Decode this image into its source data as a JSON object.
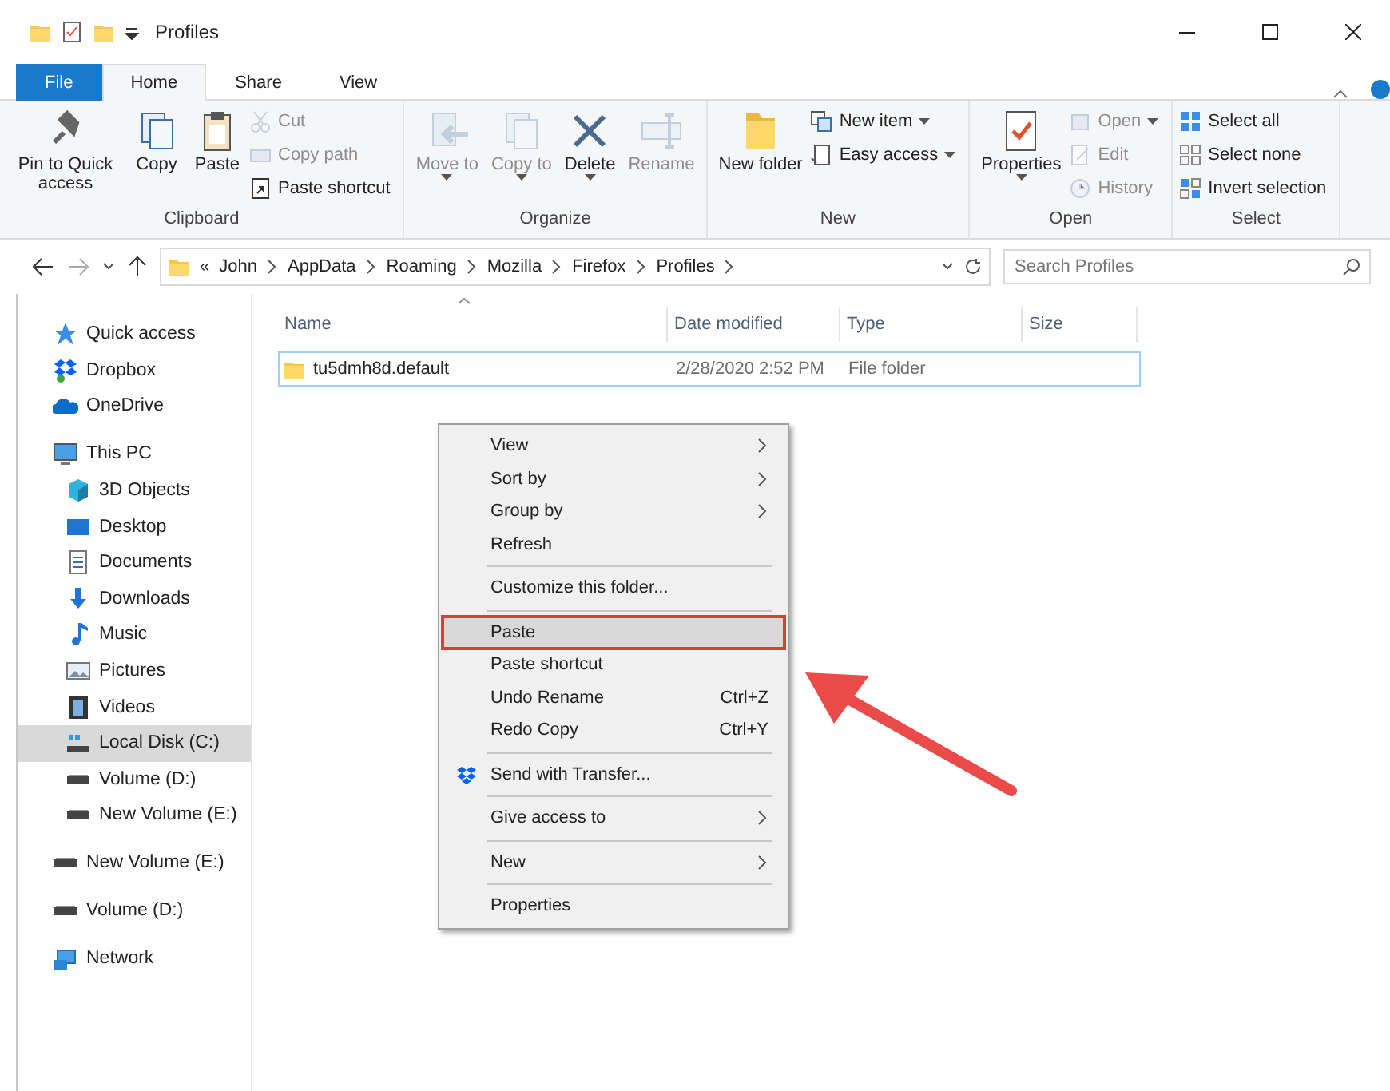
{
  "window": {
    "title": "Profiles"
  },
  "tabs": [
    {
      "label": "File",
      "kind": "file",
      "selected": false
    },
    {
      "label": "Home",
      "kind": "tab",
      "selected": true
    },
    {
      "label": "Share",
      "kind": "tab",
      "selected": false
    },
    {
      "label": "View",
      "kind": "tab",
      "selected": false
    }
  ],
  "ribbon": [
    {
      "name": "Clipboard",
      "items": [
        {
          "label": "Pin to Quick access",
          "kind": "large",
          "disabled": false
        },
        {
          "label": "Copy",
          "kind": "large",
          "disabled": false
        },
        {
          "label": "Paste",
          "kind": "large",
          "disabled": false
        },
        {
          "label": "Cut",
          "kind": "small",
          "disabled": true
        },
        {
          "label": "Copy path",
          "kind": "small",
          "disabled": true
        },
        {
          "label": "Paste shortcut",
          "kind": "small",
          "disabled": false
        }
      ]
    },
    {
      "name": "Organize",
      "items": [
        {
          "label": "Move to",
          "kind": "large",
          "disabled": true,
          "dropdown": true
        },
        {
          "label": "Copy to",
          "kind": "large",
          "disabled": true,
          "dropdown": true
        },
        {
          "label": "Delete",
          "kind": "large",
          "disabled": false,
          "dropdown": true
        },
        {
          "label": "Rename",
          "kind": "large",
          "disabled": true
        }
      ]
    },
    {
      "name": "New",
      "items": [
        {
          "label": "New folder",
          "kind": "large",
          "disabled": false
        },
        {
          "label": "New item",
          "kind": "small",
          "disabled": false,
          "dropdown": true
        },
        {
          "label": "Easy access",
          "kind": "small",
          "disabled": false,
          "dropdown": true
        }
      ]
    },
    {
      "name": "Open",
      "items": [
        {
          "label": "Properties",
          "kind": "large",
          "disabled": false,
          "dropdown": true
        },
        {
          "label": "Open",
          "kind": "small",
          "disabled": true,
          "dropdown": true
        },
        {
          "label": "Edit",
          "kind": "small",
          "disabled": true
        },
        {
          "label": "History",
          "kind": "small",
          "disabled": true
        }
      ]
    },
    {
      "name": "Select",
      "items": [
        {
          "label": "Select all",
          "kind": "small",
          "disabled": false
        },
        {
          "label": "Select none",
          "kind": "small",
          "disabled": false
        },
        {
          "label": "Invert selection",
          "kind": "small",
          "disabled": false
        }
      ]
    }
  ],
  "address": {
    "overflow": "«",
    "crumbs": [
      "John",
      "AppData",
      "Roaming",
      "Mozilla",
      "Firefox",
      "Profiles"
    ]
  },
  "search": {
    "placeholder": "Search Profiles"
  },
  "sidebar": [
    {
      "label": "Quick access",
      "kind": "star",
      "selected": false
    },
    {
      "label": "Dropbox",
      "kind": "dropbox",
      "selected": false
    },
    {
      "label": "OneDrive",
      "kind": "cloud",
      "selected": false
    },
    {
      "label": "This PC",
      "kind": "pc",
      "selected": false,
      "children": [
        {
          "label": "3D Objects",
          "kind": "cube",
          "selected": false
        },
        {
          "label": "Desktop",
          "kind": "desktop",
          "selected": false
        },
        {
          "label": "Documents",
          "kind": "doc",
          "selected": false
        },
        {
          "label": "Downloads",
          "kind": "download",
          "selected": false
        },
        {
          "label": "Music",
          "kind": "music",
          "selected": false
        },
        {
          "label": "Pictures",
          "kind": "picture",
          "selected": false
        },
        {
          "label": "Videos",
          "kind": "video",
          "selected": false
        },
        {
          "label": "Local Disk (C:)",
          "kind": "windisk",
          "selected": true
        },
        {
          "label": "Volume (D:)",
          "kind": "drive",
          "selected": false
        },
        {
          "label": "New Volume (E:)",
          "kind": "drive",
          "selected": false
        }
      ]
    },
    {
      "label": "New Volume (E:)",
      "kind": "drive",
      "selected": false
    },
    {
      "label": "Volume (D:)",
      "kind": "drive",
      "selected": false
    },
    {
      "label": "Network",
      "kind": "network",
      "selected": false
    }
  ],
  "table": {
    "columns": [
      "Name",
      "Date modified",
      "Type",
      "Size"
    ],
    "rows": [
      {
        "cells": [
          "tu5dmh8d.default",
          "2/28/2020 2:52 PM",
          "File folder"
        ],
        "focused": true
      }
    ]
  },
  "context_menu": [
    {
      "kind": "item",
      "label": "View",
      "submenu": true,
      "highlighted": false
    },
    {
      "kind": "item",
      "label": "Sort by",
      "submenu": true,
      "highlighted": false
    },
    {
      "kind": "item",
      "label": "Group by",
      "submenu": true,
      "highlighted": false
    },
    {
      "kind": "item",
      "label": "Refresh",
      "submenu": false,
      "highlighted": false
    },
    {
      "kind": "separator"
    },
    {
      "kind": "item",
      "label": "Customize this folder...",
      "submenu": false,
      "highlighted": false
    },
    {
      "kind": "separator"
    },
    {
      "kind": "item",
      "label": "Paste",
      "submenu": false,
      "highlighted": true
    },
    {
      "kind": "item",
      "label": "Paste shortcut",
      "submenu": false,
      "highlighted": false
    },
    {
      "kind": "item",
      "label": "Undo Rename",
      "shortcut": "Ctrl+Z",
      "submenu": false,
      "highlighted": false
    },
    {
      "kind": "item",
      "label": "Redo Copy",
      "shortcut": "Ctrl+Y",
      "submenu": false,
      "highlighted": false
    },
    {
      "kind": "separator"
    },
    {
      "kind": "app",
      "label": "Send with Transfer...",
      "submenu": false,
      "highlighted": false
    },
    {
      "kind": "separator"
    },
    {
      "kind": "item",
      "label": "Give access to",
      "submenu": true,
      "highlighted": false
    },
    {
      "kind": "separator"
    },
    {
      "kind": "item",
      "label": "New",
      "submenu": true,
      "highlighted": false
    },
    {
      "kind": "separator"
    },
    {
      "kind": "item",
      "label": "Properties",
      "submenu": false,
      "highlighted": false
    }
  ]
}
